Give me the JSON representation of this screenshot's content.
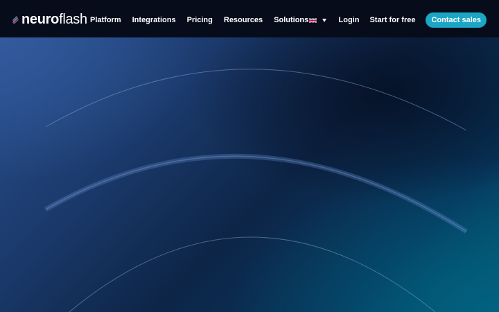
{
  "header": {
    "logo_bold": "neuro",
    "logo_light": "flash",
    "nav": [
      {
        "label": "Platform"
      },
      {
        "label": "Integrations"
      },
      {
        "label": "Pricing"
      },
      {
        "label": "Resources"
      },
      {
        "label": "Solutions"
      }
    ],
    "language_icon": "uk-flag-icon",
    "login_label": "Login",
    "start_free_label": "Start for free",
    "contact_sales_label": "Contact sales"
  },
  "colors": {
    "header_bg": "#060c1a",
    "accent": "#1aa6c4",
    "hero_top_left": "#2a4f8e",
    "hero_bottom_right": "#055b74"
  }
}
